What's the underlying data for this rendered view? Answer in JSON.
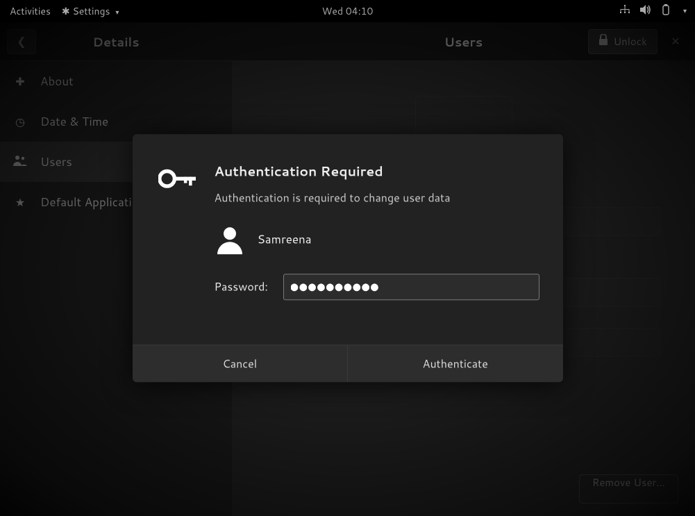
{
  "shell": {
    "activities": "Activities",
    "current_app": "Settings",
    "clock": "Wed 04:10"
  },
  "header": {
    "left_title": "Details",
    "right_title": "Users",
    "unlock_label": "Unlock"
  },
  "sidebar": {
    "items": [
      {
        "label": "About"
      },
      {
        "label": "Date & Time"
      },
      {
        "label": "Users"
      },
      {
        "label": "Default Applications"
      }
    ]
  },
  "content": {
    "remove_user_label": "Remove User…"
  },
  "dialog": {
    "title": "Authentication Required",
    "message": "Authentication is required to change user data",
    "user_name": "Samreena",
    "password_label": "Password:",
    "password_value": "●●●●●●●●●●",
    "cancel_label": "Cancel",
    "authenticate_label": "Authenticate"
  }
}
